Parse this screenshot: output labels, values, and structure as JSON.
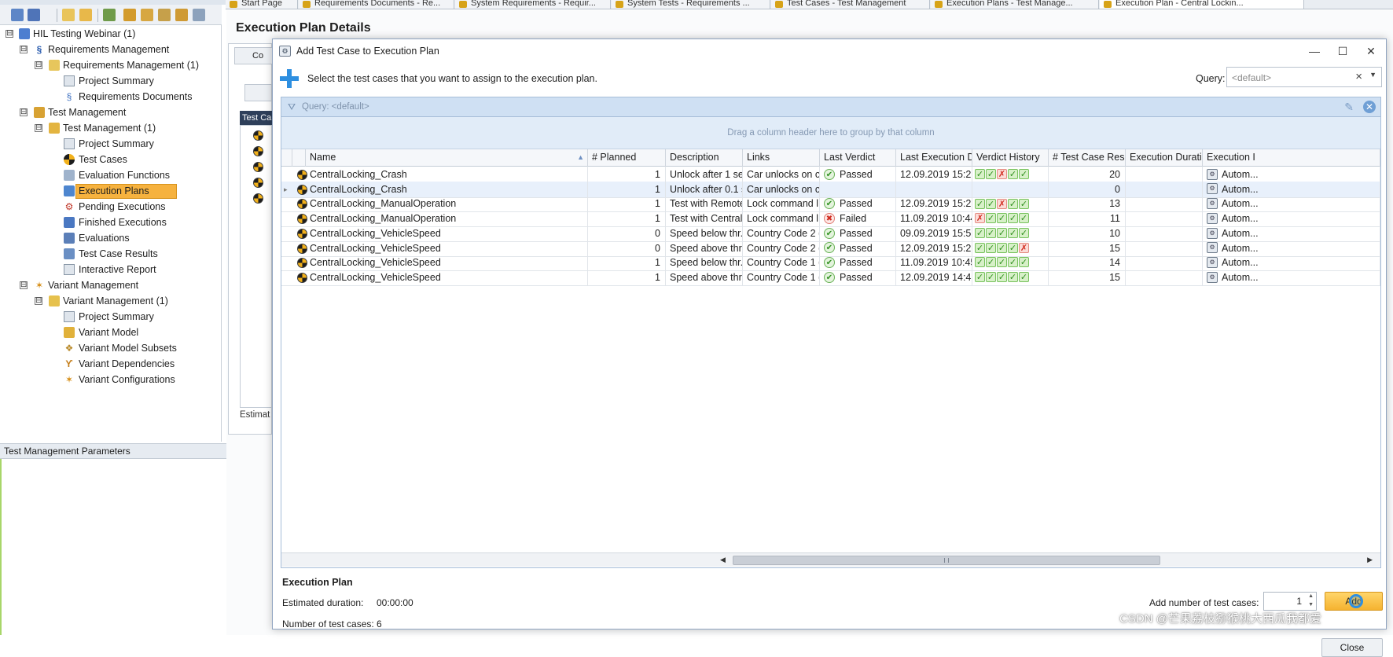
{
  "doc_tabs": [
    {
      "label": "Start Page"
    },
    {
      "label": "Requirements Documents - Re..."
    },
    {
      "label": "System Requirements - Requir..."
    },
    {
      "label": "System Tests - Requirements ..."
    },
    {
      "label": "Test Cases - Test Management"
    },
    {
      "label": "Execution Plans - Test Manage..."
    },
    {
      "label": "Execution Plan - Central Lockin..."
    }
  ],
  "tree": {
    "items": [
      {
        "label": "HIL Testing Webinar (1)",
        "expander": "⊟"
      },
      {
        "label": "Requirements Management",
        "expander": "⊟"
      },
      {
        "label": "Requirements Management (1)",
        "expander": "⊟"
      },
      {
        "label": "Project Summary"
      },
      {
        "label": "Requirements Documents"
      },
      {
        "label": "Test Management",
        "expander": "⊟"
      },
      {
        "label": "Test Management  (1)",
        "expander": "⊟"
      },
      {
        "label": "Project Summary"
      },
      {
        "label": "Test Cases"
      },
      {
        "label": "Evaluation Functions"
      },
      {
        "label": "Execution Plans"
      },
      {
        "label": "Pending Executions"
      },
      {
        "label": "Finished Executions"
      },
      {
        "label": "Evaluations"
      },
      {
        "label": "Test Case Results"
      },
      {
        "label": "Interactive Report"
      },
      {
        "label": "Variant Management",
        "expander": "⊟"
      },
      {
        "label": "Variant Management (1)",
        "expander": "⊟"
      },
      {
        "label": "Project Summary"
      },
      {
        "label": "Variant Model"
      },
      {
        "label": "Variant Model Subsets"
      },
      {
        "label": "Variant Dependencies"
      },
      {
        "label": "Variant Configurations"
      }
    ]
  },
  "params_panel": {
    "title": "Test Management Parameters"
  },
  "background_doc": {
    "title": "Execution Plan Details",
    "tab_label": "Co",
    "grid_header": "Test Ca",
    "estimate_label": "Estimat"
  },
  "dialog": {
    "title": "Add Test Case to Execution Plan",
    "minimize": "—",
    "maximize": "☐",
    "close": "✕",
    "instruction": "Select the test cases that you want to assign to the execution plan.",
    "query_label": "Query:",
    "query_value": "<default>",
    "filter_text": "Query: <default>",
    "group_hint": "Drag a column header here to group by that column",
    "columns": [
      "Name",
      "# Planned",
      "Description",
      "Links",
      "Last Verdict",
      "Last Execution D...",
      "Verdict History",
      "# Test Case Results",
      "Execution Duration",
      "Execution I"
    ],
    "rows": [
      {
        "name": "CentralLocking_Crash",
        "planned": "1",
        "description": "Unlock after 1 se...",
        "links": "Car unlocks on cr...",
        "verdict": "Passed",
        "last_exec": "12.09.2019 15:21:...",
        "history": [
          "ok",
          "ok",
          "bad",
          "ok",
          "ok"
        ],
        "results": "20",
        "duration": "",
        "exec": "Autom..."
      },
      {
        "name": "CentralLocking_Crash",
        "planned": "1",
        "description": "Unlock after 0.1 s...",
        "links": "Car unlocks on cr...",
        "verdict": "",
        "last_exec": "",
        "history": [],
        "results": "0",
        "duration": "",
        "exec": "Autom..."
      },
      {
        "name": "CentralLocking_ManualOperation",
        "planned": "1",
        "description": "Test with Remote...",
        "links": "Lock command l...",
        "verdict": "Passed",
        "last_exec": "12.09.2019 15:21:...",
        "history": [
          "ok",
          "ok",
          "bad",
          "ok",
          "ok"
        ],
        "results": "13",
        "duration": "",
        "exec": "Autom..."
      },
      {
        "name": "CentralLocking_ManualOperation",
        "planned": "1",
        "description": "Test with Central...",
        "links": "Lock command l...",
        "verdict": "Failed",
        "last_exec": "11.09.2019 10:44:...",
        "history": [
          "bad",
          "ok",
          "ok",
          "ok",
          "ok"
        ],
        "results": "11",
        "duration": "",
        "exec": "Autom..."
      },
      {
        "name": "CentralLocking_VehicleSpeed",
        "planned": "0",
        "description": "Speed below thr...",
        "links": "Country Code 2 (...",
        "verdict": "Passed",
        "last_exec": "09.09.2019 15:51:...",
        "history": [
          "ok",
          "ok",
          "ok",
          "ok",
          "ok"
        ],
        "results": "10",
        "duration": "",
        "exec": "Autom..."
      },
      {
        "name": "CentralLocking_VehicleSpeed",
        "planned": "0",
        "description": "Speed above thr...",
        "links": "Country Code 2 (...",
        "verdict": "Passed",
        "last_exec": "12.09.2019 15:22:...",
        "history": [
          "ok",
          "ok",
          "ok",
          "ok",
          "bad"
        ],
        "results": "15",
        "duration": "",
        "exec": "Autom..."
      },
      {
        "name": "CentralLocking_VehicleSpeed",
        "planned": "1",
        "description": "Speed below thr...",
        "links": "Country Code 1 (...",
        "verdict": "Passed",
        "last_exec": "11.09.2019 10:45:...",
        "history": [
          "ok",
          "ok",
          "ok",
          "ok",
          "ok"
        ],
        "results": "14",
        "duration": "",
        "exec": "Autom..."
      },
      {
        "name": "CentralLocking_VehicleSpeed",
        "planned": "1",
        "description": "Speed above thr...",
        "links": "Country Code 1 (...",
        "verdict": "Passed",
        "last_exec": "12.09.2019 14:48:...",
        "history": [
          "ok",
          "ok",
          "ok",
          "ok",
          "ok"
        ],
        "results": "15",
        "duration": "",
        "exec": "Autom..."
      }
    ],
    "section_title": "Execution Plan",
    "estimated_label": "Estimated duration:",
    "estimated_value": "00:00:00",
    "count_label": "Number of test cases:",
    "count_value": "6",
    "add_count_label": "Add number of test cases:",
    "add_count_value": "1",
    "add_button": "Add",
    "close_button": "Close"
  },
  "watermark": "CSDN @芒果荔枝猕猴桃大西瓜我都爱",
  "colors": {
    "accent": "#f6b23f",
    "filter_bar": "#cfe0f3",
    "passed": "#2f8f1e",
    "failed": "#d12b1f"
  }
}
